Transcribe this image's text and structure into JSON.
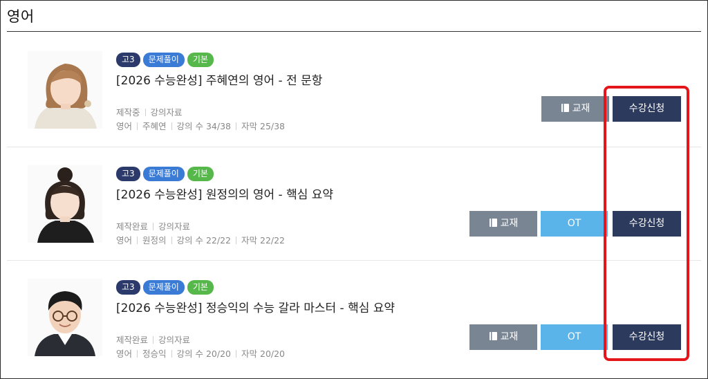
{
  "section": {
    "title": "영어"
  },
  "courses": [
    {
      "tags": [
        "고3",
        "문제풀이",
        "기본"
      ],
      "title": "[2026 수능완성] 주혜연의 영어 - 전 문항",
      "status": "제작중",
      "material": "강의자료",
      "subject": "영어",
      "teacher": "주혜연",
      "lectures": "강의 수 34/38",
      "subtitles": "자막 25/38",
      "book_label": "교재",
      "enroll_label": "수강신청"
    },
    {
      "tags": [
        "고3",
        "문제풀이",
        "기본"
      ],
      "title": "[2026 수능완성] 원정의의 영어 - 핵심 요약",
      "status": "제작완료",
      "material": "강의자료",
      "subject": "영어",
      "teacher": "원정의",
      "lectures": "강의 수 22/22",
      "subtitles": "자막 22/22",
      "book_label": "교재",
      "ot_label": "OT",
      "enroll_label": "수강신청"
    },
    {
      "tags": [
        "고3",
        "문제풀이",
        "기본"
      ],
      "title": "[2026 수능완성] 정승익의 수능 갈라 마스터 - 핵심 요약",
      "status": "제작완료",
      "material": "강의자료",
      "subject": "영어",
      "teacher": "정승익",
      "lectures": "강의 수 20/20",
      "subtitles": "자막 20/20",
      "book_label": "교재",
      "ot_label": "OT",
      "enroll_label": "수강신청"
    }
  ],
  "colors": {
    "grade_tag": "#2b3a6b",
    "type_tag": "#3a7bd5",
    "level_tag": "#56b84a",
    "book_button": "#7a8593",
    "ot_button": "#5ab4ea",
    "enroll_button": "#2c3a5e",
    "highlight": "#e5161b"
  },
  "icons": {
    "book": "book-icon"
  }
}
